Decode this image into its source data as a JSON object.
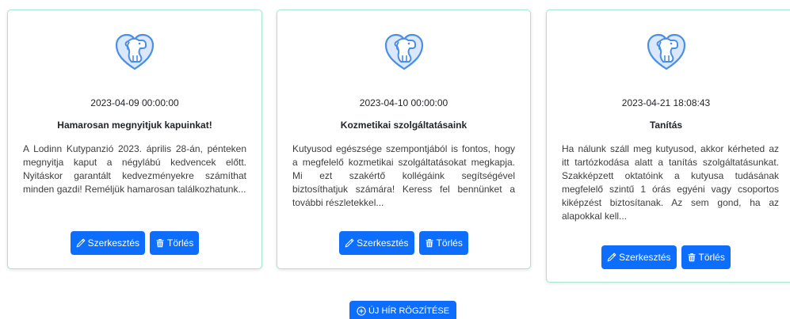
{
  "news": [
    {
      "date": "2023-04-09 00:00:00",
      "title": "Hamarosan megnyitjuk kapuinkat!",
      "body": "A Lodinn Kutypanzió 2023. április 28-án, pénteken megnyitja kaput a négylábú kedvencek előtt. Nyitáskor garantált kedvezményekre számíthat minden gazdi! Reméljük hamarosan találkozhatunk...",
      "edit_label": "Szerkesztés",
      "delete_label": "Törlés"
    },
    {
      "date": "2023-04-10 00:00:00",
      "title": "Kozmetikai szolgáltatásaink",
      "body": "Kutyusod egészsége szempontjából is fontos, hogy a megfelelő kozmetikai szolgáltatásokat megkapja. Mi ezt szakértő kollégáink segítségével biztosíthatjuk számára! Keress fel bennünket a további részletekkel...",
      "edit_label": "Szerkesztés",
      "delete_label": "Törlés"
    },
    {
      "date": "2023-04-21 18:08:43",
      "title": "Tanítás",
      "body": "Ha nálunk száll meg kutyusod, akkor kérheted az itt tartózkodása alatt a tanítás szolgáltatásunkat. Szakképzett oktatóink a kutyusa tudásának megfelelő szintű 1 órás egyéni vagy csoportos kiképzést biztosítanak. Az sem gond, ha az alapokkal kell...",
      "edit_label": "Szerkesztés",
      "delete_label": "Törlés"
    }
  ],
  "new_news_label": "ÚJ HÍR RÖGZÍTÉSE",
  "icons": {
    "logo": "dog-heart-logo-icon",
    "edit": "pencil-icon",
    "delete": "trash-icon",
    "add": "plus-circle-icon"
  },
  "colors": {
    "primary": "#0d6efd",
    "card_border": "#a8e6cf",
    "logo_blue": "#4a8fe7"
  }
}
